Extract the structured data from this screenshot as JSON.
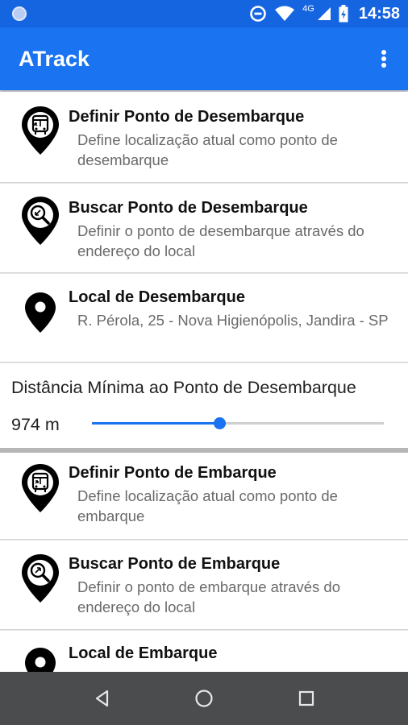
{
  "status_bar": {
    "network": "4G",
    "time": "14:58",
    "icons": [
      "notification-circle-icon",
      "data-saver-icon",
      "wifi-icon",
      "cell-signal-icon",
      "battery-charging-icon"
    ]
  },
  "app_bar": {
    "title": "ATrack",
    "menu_icon": "more-vert-icon"
  },
  "desembarque": {
    "definir": {
      "title": "Definir Ponto de Desembarque",
      "subtitle": "Define localização atual como ponto de desembarque",
      "icon": "bus-pin-icon"
    },
    "buscar": {
      "title": "Buscar Ponto de Desembarque",
      "subtitle": "Definir o ponto de desembarque através do endereço do local",
      "icon": "search-pin-icon"
    },
    "local": {
      "title": "Local de Desembarque",
      "subtitle": "R. Pérola, 25 - Nova Higienópolis, Jandira - SP",
      "icon": "location-pin-icon"
    }
  },
  "distance": {
    "label": "Distância Mínima ao Ponto de Desembarque",
    "value_text": "974 m",
    "slider_fraction": 0.437
  },
  "embarque": {
    "definir": {
      "title": "Definir Ponto de Embarque",
      "subtitle": "Define localização atual como ponto de embarque",
      "icon": "bus-pin-icon"
    },
    "buscar": {
      "title": "Buscar Ponto de Embarque",
      "subtitle": "Definir o ponto de embarque através do endereço do local",
      "icon": "search-pin-icon"
    },
    "local": {
      "title": "Local de Embarque",
      "icon": "location-pin-icon"
    }
  },
  "nav_bar": {
    "buttons": [
      "back-icon",
      "home-icon",
      "recents-icon"
    ]
  },
  "colors": {
    "status_bar": "#1565e0",
    "app_bar": "#1a73f0",
    "accent": "#1a73f0",
    "nav_bar": "#4a4c4e"
  }
}
